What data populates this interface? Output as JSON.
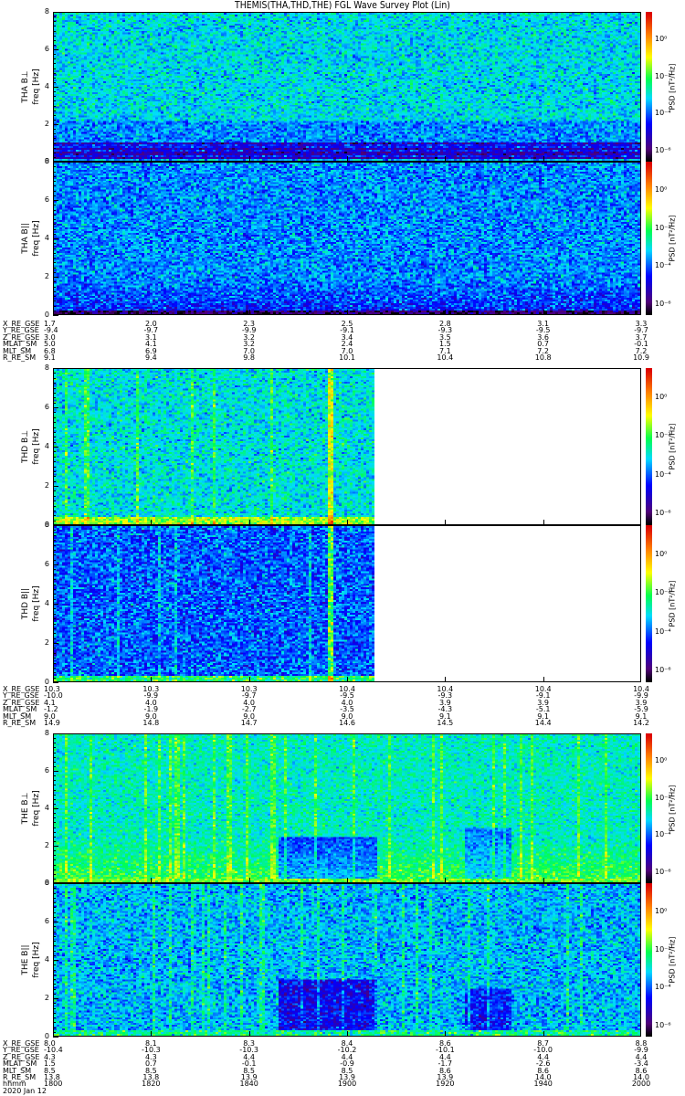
{
  "title": "THEMIS(THA,THD,THE) FGL Wave Survey Plot (Lin)",
  "colorbar": {
    "label": "PSD [nT²/Hz]",
    "ticks": [
      "10⁰",
      "10⁻²",
      "10⁻⁴",
      "10⁻⁶"
    ],
    "range_log10": [
      -6.6,
      1.5
    ]
  },
  "panels": [
    {
      "id": "tha-bperp",
      "label": "THA B⊥",
      "ylabel": "freq [Hz]"
    },
    {
      "id": "tha-bpar",
      "label": "THA B||",
      "ylabel": "freq [Hz]"
    },
    {
      "id": "thd-bperp",
      "label": "THD B⊥",
      "ylabel": "freq [Hz]"
    },
    {
      "id": "thd-bpar",
      "label": "THD B||",
      "ylabel": "freq [Hz]"
    },
    {
      "id": "the-bperp",
      "label": "THE B⊥",
      "ylabel": "freq [Hz]"
    },
    {
      "id": "the-bpar",
      "label": "THE B||",
      "ylabel": "freq [Hz]"
    }
  ],
  "yticks": [
    "0",
    "2",
    "4",
    "6",
    "8"
  ],
  "ephemeris": [
    {
      "probe": "THA",
      "rows": [
        {
          "label": "X_RE_GSE",
          "values": [
            "1.7",
            "2.0",
            "2.3",
            "2.5",
            "2.8",
            "3.1",
            "3.3"
          ]
        },
        {
          "label": "Y_RE_GSE",
          "values": [
            "-9.4",
            "-9.7",
            "-9.9",
            "-9.1",
            "-9.3",
            "-9.5",
            "-9.7"
          ]
        },
        {
          "label": "Z_RE_GSE",
          "values": [
            "3.0",
            "3.1",
            "3.2",
            "3.4",
            "3.5",
            "3.6",
            "3.7"
          ]
        },
        {
          "label": "MLAT_SM",
          "values": [
            "5.0",
            "4.1",
            "3.2",
            "2.4",
            "1.5",
            "0.7",
            "-0.1"
          ]
        },
        {
          "label": "MLT_SM",
          "values": [
            "6.8",
            "6.9",
            "7.0",
            "7.0",
            "7.1",
            "7.2",
            "7.2"
          ]
        },
        {
          "label": "R_RE_SM",
          "values": [
            "9.1",
            "9.4",
            "9.8",
            "10.1",
            "10.4",
            "10.8",
            "10.9"
          ]
        }
      ]
    },
    {
      "probe": "THD",
      "rows": [
        {
          "label": "X_RE_GSE",
          "values": [
            "10.3",
            "10.3",
            "10.3",
            "10.4",
            "10.4",
            "10.4",
            "10.4"
          ]
        },
        {
          "label": "Y_RE_GSE",
          "values": [
            "-10.0",
            "-9.9",
            "-9.7",
            "-9.5",
            "-9.3",
            "-9.1",
            "-9.9"
          ]
        },
        {
          "label": "Z_RE_GSE",
          "values": [
            "4.1",
            "4.0",
            "4.0",
            "4.0",
            "3.9",
            "3.9",
            "3.9"
          ]
        },
        {
          "label": "MLAT_SM",
          "values": [
            "-1.2",
            "-1.9",
            "-2.7",
            "-3.5",
            "-4.3",
            "-5.1",
            "-5.9"
          ]
        },
        {
          "label": "MLT_SM",
          "values": [
            "9.0",
            "9.0",
            "9.0",
            "9.0",
            "9.1",
            "9.1",
            "9.1"
          ]
        },
        {
          "label": "R_RE_SM",
          "values": [
            "14.9",
            "14.8",
            "14.7",
            "14.6",
            "14.5",
            "14.4",
            "14.2"
          ]
        }
      ]
    },
    {
      "probe": "THE",
      "rows": [
        {
          "label": "X_RE_GSE",
          "values": [
            "8.0",
            "8.1",
            "8.3",
            "8.4",
            "8.6",
            "8.7",
            "8.8"
          ]
        },
        {
          "label": "Y_RE_GSE",
          "values": [
            "-10.4",
            "-10.3",
            "-10.3",
            "-10.2",
            "-10.1",
            "-10.0",
            "-9.9"
          ]
        },
        {
          "label": "Z_RE_GSE",
          "values": [
            "4.3",
            "4.3",
            "4.4",
            "4.4",
            "4.4",
            "4.4",
            "4.4"
          ]
        },
        {
          "label": "MLAT_SM",
          "values": [
            "1.5",
            "0.7",
            "-0.1",
            "-0.9",
            "-1.7",
            "-2.6",
            "-3.4"
          ]
        },
        {
          "label": "MLT_SM",
          "values": [
            "8.5",
            "8.5",
            "8.5",
            "8.5",
            "8.6",
            "8.6",
            "8.6"
          ]
        },
        {
          "label": "R_RE_SM",
          "values": [
            "13.8",
            "13.8",
            "13.9",
            "13.9",
            "13.9",
            "14.0",
            "14.0"
          ]
        },
        {
          "label": "hhmm",
          "values": [
            "1800",
            "1820",
            "1840",
            "1900",
            "1920",
            "1940",
            "2000"
          ]
        }
      ],
      "date": "2020 Jan 12"
    }
  ],
  "chart_data": {
    "type": "heatmap",
    "title": "THEMIS(THA,THD,THE) FGL Wave Survey Plot (Lin)",
    "xlabel": "hhmm",
    "x_ticks": [
      "1800",
      "1820",
      "1840",
      "1900",
      "1920",
      "1940",
      "2000"
    ],
    "xlim": [
      "1800",
      "2000"
    ],
    "ylabel": "freq [Hz]",
    "ylim": [
      0,
      8
    ],
    "z_label": "PSD [nT²/Hz]",
    "z_scale": "log",
    "zlim_log10": [
      -6.6,
      1.5
    ],
    "series": [
      {
        "name": "THA B⊥",
        "typical_log10_psd": -3.5,
        "note_low_freq_band_log10": -5.5
      },
      {
        "name": "THA B||",
        "typical_log10_psd": -4.2
      },
      {
        "name": "THD B⊥",
        "typical_log10_psd": -3.0,
        "data_end": "1850"
      },
      {
        "name": "THD B||",
        "typical_log10_psd": -4.0,
        "data_end": "1850"
      },
      {
        "name": "THE B⊥",
        "typical_log10_psd": -2.5
      },
      {
        "name": "THE B||",
        "typical_log10_psd": -3.5
      }
    ]
  }
}
